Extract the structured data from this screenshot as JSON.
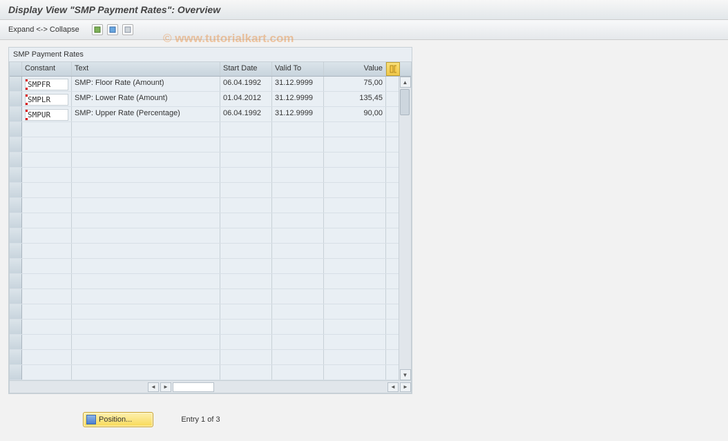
{
  "title": "Display View \"SMP Payment Rates\": Overview",
  "toolbar": {
    "expand_collapse": "Expand <-> Collapse"
  },
  "watermark": "© www.tutorialkart.com",
  "panel": {
    "title": "SMP Payment Rates"
  },
  "columns": {
    "constant": "Constant",
    "text": "Text",
    "start": "Start Date",
    "valid": "Valid To",
    "value": "Value"
  },
  "rows": [
    {
      "constant": "SMPFR",
      "text": "SMP: Floor Rate (Amount)",
      "start": "06.04.1992",
      "valid": "31.12.9999",
      "value": "75,00"
    },
    {
      "constant": "SMPLR",
      "text": "SMP: Lower Rate (Amount)",
      "start": "01.04.2012",
      "valid": "31.12.9999",
      "value": "135,45"
    },
    {
      "constant": "SMPUR",
      "text": "SMP: Upper Rate (Percentage)",
      "start": "06.04.1992",
      "valid": "31.12.9999",
      "value": "90,00"
    }
  ],
  "footer": {
    "position_label": "Position...",
    "entry_text": "Entry 1 of 3"
  }
}
